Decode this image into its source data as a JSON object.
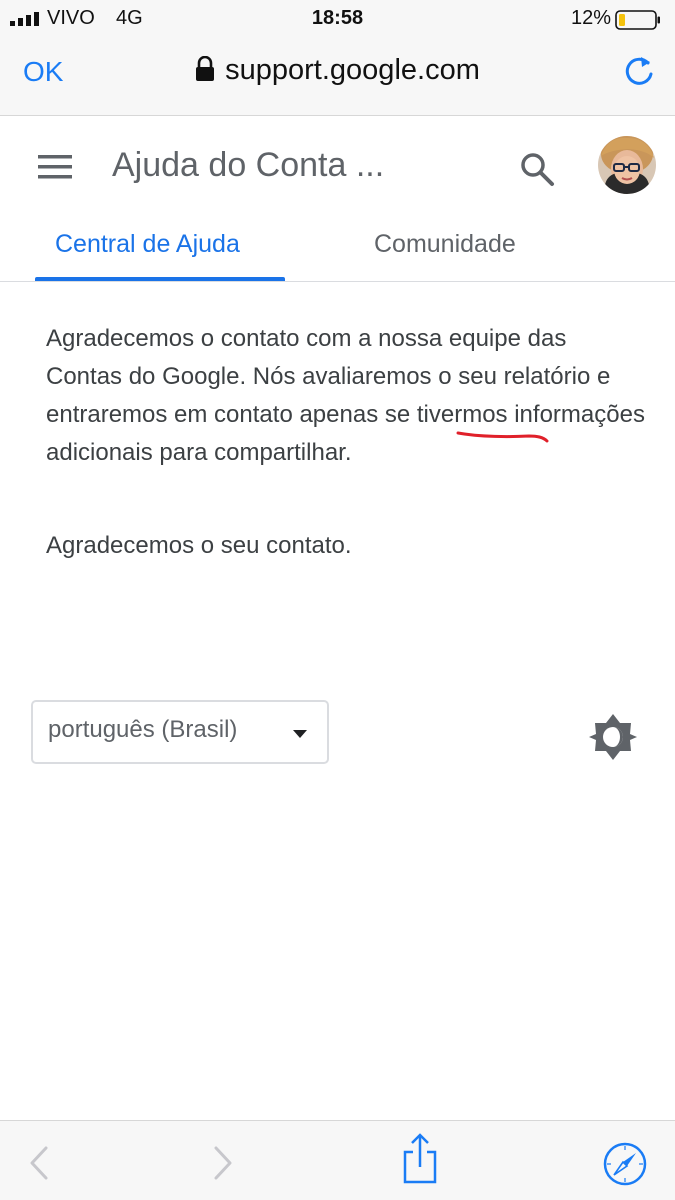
{
  "status_bar": {
    "carrier": "VIVO",
    "network": "4G",
    "time": "18:58",
    "battery": "12%"
  },
  "browser": {
    "done_label": "OK",
    "url": "support.google.com",
    "accent_color": "#1a7cf5"
  },
  "header": {
    "title": "Ajuda do Conta ...",
    "icons": [
      "menu-icon",
      "search-icon",
      "avatar"
    ]
  },
  "tabs": [
    {
      "label": "Central de Ajuda",
      "selected": true
    },
    {
      "label": "Comunidade",
      "selected": false
    }
  ],
  "main": {
    "message": "Agradecemos o contato com a nossa equipe das Contas do Google. Nós avaliaremos o seu relatório e entraremos em contato apenas se tivermos informações adicionais para compartilhar.",
    "thanks": "Agradecemos o seu contato."
  },
  "footer": {
    "language": "português (Brasil)",
    "theme_icon": "brightness-icon"
  },
  "colors": {
    "google_blue": "#1a73e8",
    "text": "#3c4043",
    "annotation_red": "#e0202a"
  }
}
